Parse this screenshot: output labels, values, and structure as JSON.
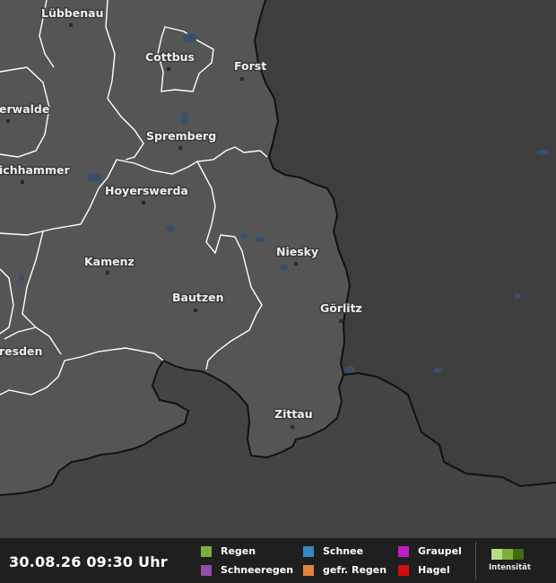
{
  "map": {
    "cities": [
      "Lübbenau",
      "Cottbus",
      "Forst",
      "erwalde",
      "Spremberg",
      "ichhammer",
      "Hoyerswerda",
      "Niesky",
      "Kamenz",
      "Bautzen",
      "Görlitz",
      "resden",
      "Zittau"
    ]
  },
  "legend": {
    "timestamp": "30.08.26 09:30 Uhr",
    "items": [
      {
        "label": "Regen",
        "color": "#7fae3c"
      },
      {
        "label": "Schneeregen",
        "color": "#8f4faa"
      },
      {
        "label": "Schnee",
        "color": "#3a86c0"
      },
      {
        "label": "gefr. Regen",
        "color": "#e0873c"
      },
      {
        "label": "Graupel",
        "color": "#c41ac4"
      },
      {
        "label": "Hagel",
        "color": "#d40e0e"
      }
    ],
    "intensity_label": "Intensität",
    "intensity_colors": [
      "#b8dc86",
      "#7fae3c",
      "#3f6b12"
    ]
  }
}
